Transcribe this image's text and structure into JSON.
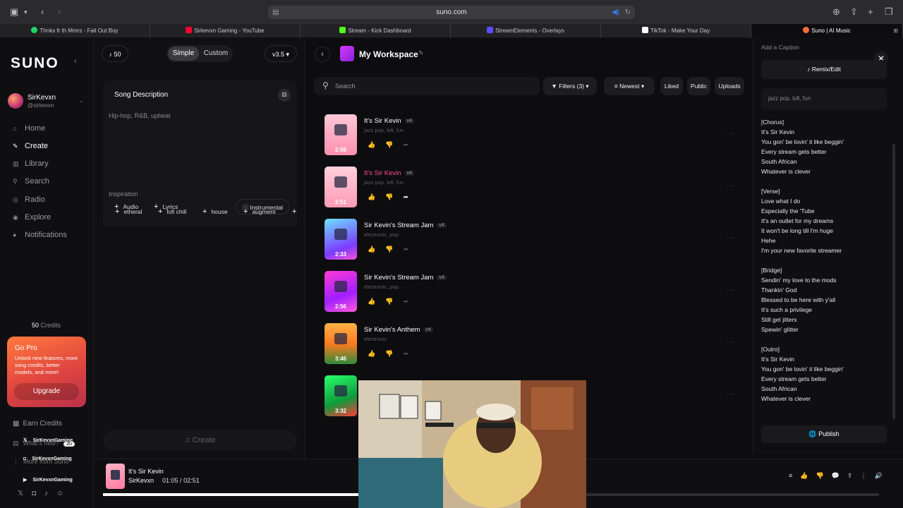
{
  "browser": {
    "url": "suno.com",
    "tabs": [
      {
        "label": "Thnks fr th Mmrs - Fall Out Boy",
        "color": "#1ed760"
      },
      {
        "label": "Sirkevxn Gaming - YouTube",
        "color": "#ff0033"
      },
      {
        "label": "Stream - Kick Dashboard",
        "color": "#53fc18"
      },
      {
        "label": "StreamElements - Overlays",
        "color": "#5a4dff"
      },
      {
        "label": "TikTok - Make Your Day",
        "color": "#ffffff"
      },
      {
        "label": "Suno | AI Music",
        "color": "#ff6a3d"
      }
    ]
  },
  "sidebar": {
    "logo": "SUNO",
    "user": {
      "name": "SirKevxn",
      "handle": "@sirkevxn"
    },
    "items": [
      {
        "label": "Home",
        "icon": "home-icon",
        "glyph": "⌂"
      },
      {
        "label": "Create",
        "icon": "create-icon",
        "glyph": "✎"
      },
      {
        "label": "Library",
        "icon": "library-icon",
        "glyph": "▥"
      },
      {
        "label": "Search",
        "icon": "search-icon",
        "glyph": "⚲"
      },
      {
        "label": "Radio",
        "icon": "radio-icon",
        "glyph": "◎"
      },
      {
        "label": "Explore",
        "icon": "explore-icon",
        "glyph": "◉"
      },
      {
        "label": "Notifications",
        "icon": "bell-icon",
        "glyph": "●"
      }
    ],
    "credits_value": "50",
    "credits_label": "Credits",
    "gopro": {
      "title": "Go Pro",
      "text": "Unlock new features, more song credits, better models, and more!",
      "button": "Upgrade"
    },
    "earn_credits": "Earn Credits",
    "whats_new": "What's new?",
    "whats_new_count": "20",
    "more_from_suno": "More from Suno",
    "stream_overlays": [
      "SirKevxnGaming",
      "SirKevxnGaming",
      "SirKevxnGaming"
    ]
  },
  "create": {
    "credits_pill": "50",
    "mode_simple": "Simple",
    "mode_custom": "Custom",
    "version": "v3.5",
    "description_label": "Song Description",
    "description_value": "Hip-hop, R&B, upbeat",
    "audio_label": "Audio",
    "lyrics_label": "Lyrics",
    "instrumental_label": "Instrumental",
    "inspiration_label": "Inspiration",
    "inspiration_chips": [
      "etheral",
      "lofi chill",
      "house",
      "augment"
    ],
    "create_button": "Create"
  },
  "workspace": {
    "title": "My Workspace",
    "search_placeholder": "Search",
    "filters": {
      "filters_label": "Filters (3)",
      "sort_label": "Newest",
      "liked": "Liked",
      "public": "Public",
      "uploads": "Uploads"
    },
    "songs": [
      {
        "title": "It's Sir Kevin",
        "version": "v4",
        "tags": "jazz pop, lofi, fun",
        "duration": "2:08",
        "playing": false,
        "thumb": "linear-gradient(180deg,#ffc7d6,#ff8fb0)"
      },
      {
        "title": "It's Sir Kevin",
        "version": "v4",
        "tags": "jazz pop, lofi, fun",
        "duration": "2:51",
        "playing": true,
        "thumb": "linear-gradient(180deg,#ffd0dc,#ff9bb5)"
      },
      {
        "title": "Sir Kevin's Stream Jam",
        "version": "v4",
        "tags": "electronic, pop",
        "duration": "2:33",
        "playing": false,
        "thumb": "linear-gradient(160deg,#6ee0ff,#7b3cff 70%,#ff4fd8)"
      },
      {
        "title": "Sir Kevin's Stream Jam",
        "version": "v4",
        "tags": "electronic, pop",
        "duration": "2:56",
        "playing": false,
        "thumb": "linear-gradient(160deg,#ff3ad4,#a21fff 60%,#ff5bd8)"
      },
      {
        "title": "Sir Kevin's Anthem",
        "version": "v4",
        "tags": "electronic",
        "duration": "3:46",
        "playing": false,
        "thumb": "linear-gradient(180deg,#ffb347,#ff7a1f 50%,#2e8b3a)"
      },
      {
        "title": "",
        "version": "",
        "tags": "",
        "duration": "3:32",
        "playing": false,
        "thumb": "linear-gradient(160deg,#2bff6e,#0e9b3a 60%,#ff3a3a)"
      }
    ]
  },
  "right_panel": {
    "caption_placeholder": "Add a Caption",
    "remix_label": "Remix/Edit",
    "tags": "jazz pop, lofi, fun",
    "lyrics": [
      "[Chorus]",
      "It's Sir Kevin",
      "You gon' be lovin' it like beggin'",
      "Every stream gets better",
      "South African",
      "Whatever is clever",
      "",
      "[Verse]",
      "Love what I do",
      "Especially the 'Tube",
      "It's an outlet for my dreams",
      "It won't be long till I'm huge",
      "Hehe",
      "I'm your new favorite streamer",
      "",
      "[Bridge]",
      "Sendin' my love to the mods",
      "Thankin' God",
      "Blessed to be here with y'all",
      "It's such a privilege",
      "Still get jitters",
      "Spewin' glitter",
      "",
      "[Outro]",
      "It's Sir Kevin",
      "You gon' be lovin' it like beggin'",
      "Every stream gets better",
      "South African",
      "Whatever is clever"
    ],
    "publish_label": "Publish"
  },
  "player": {
    "title": "It's Sir Kevin",
    "artist": "SirKevxn",
    "current_time": "01:05",
    "total_time": "02:51",
    "time_separator": "/",
    "progress": 0.38
  },
  "colors": {
    "accent_pink": "#ff4d8d",
    "gopro_orange": "#ff7a3d"
  }
}
